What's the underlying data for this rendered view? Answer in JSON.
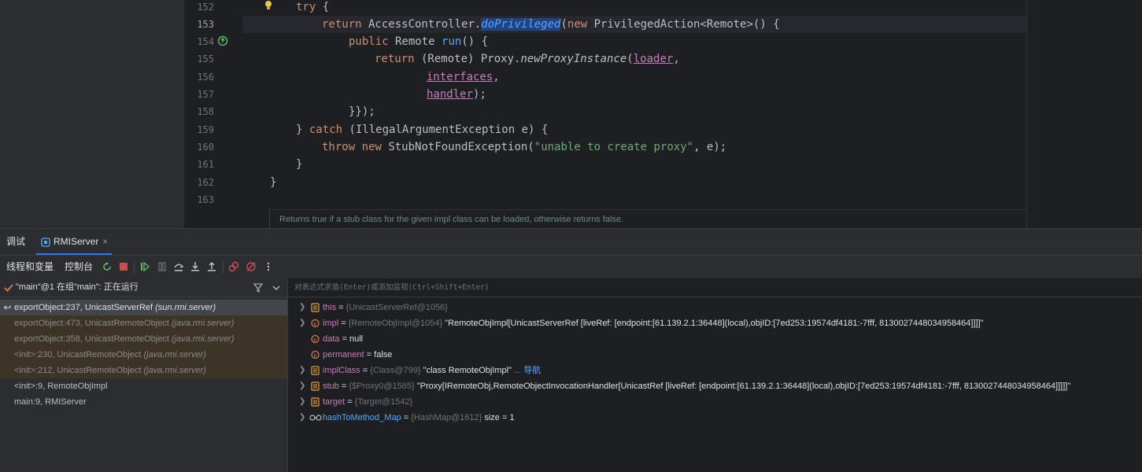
{
  "editor": {
    "line_numbers": [
      "152",
      "153",
      "154",
      "155",
      "156",
      "157",
      "158",
      "159",
      "160",
      "161",
      "162",
      "163"
    ],
    "code": {
      "l152": {
        "kw": "try",
        "rest": " {"
      },
      "l153": {
        "kw": "return",
        "a": " AccessController.",
        "fn": "doPrivileged",
        "b": "(",
        "kw2": "new",
        "c": " PrivilegedAction<Remote>() {"
      },
      "l154": {
        "kw": "public",
        "a": " Remote ",
        "fn": "run",
        "b": "() {"
      },
      "l155": {
        "kw": "return",
        "a": " (Remote) Proxy.",
        "fn": "newProxyInstance",
        "b": "(",
        "param": "loader",
        "c": ","
      },
      "l156": {
        "param": "interfaces",
        "c": ","
      },
      "l157": {
        "param": "handler",
        "c": ");"
      },
      "l158": {
        "a": "}});"
      },
      "l159": {
        "a": "} ",
        "kw": "catch",
        "b": " (IllegalArgumentException e) {"
      },
      "l160": {
        "kw": "throw",
        "a": " ",
        "kw2": "new",
        "b": " StubNotFoundException(",
        "str": "\"unable to create proxy\"",
        "c": ", e);"
      },
      "l161": {
        "a": "}"
      },
      "l162": {
        "a": "}"
      }
    },
    "doc_hint": "Returns true if a stub class for the given impl class can be loaded, otherwise returns false."
  },
  "tool_window": {
    "tab_debug": "调试",
    "tab_config": "RMIServer",
    "tab_close": "×"
  },
  "toolbar": {
    "threads_vars": "线程和变量",
    "console": "控制台"
  },
  "thread": {
    "label": "\"main\"@1 在组\"main\": 正在运行"
  },
  "frames": [
    {
      "method": "exportObject:237, UnicastServerRef ",
      "pkg": "(sun.rmi.server)"
    },
    {
      "method": "exportObject:473, UnicastRemoteObject ",
      "pkg": "(java.rmi.server)"
    },
    {
      "method": "exportObject:358, UnicastRemoteObject ",
      "pkg": "(java.rmi.server)"
    },
    {
      "method": "<init>:230, UnicastRemoteObject ",
      "pkg": "(java.rmi.server)"
    },
    {
      "method": "<init>:212, UnicastRemoteObject ",
      "pkg": "(java.rmi.server)"
    },
    {
      "method": "<init>:9, RemoteObjImpl",
      "pkg": ""
    },
    {
      "method": "main:9, RMIServer",
      "pkg": ""
    }
  ],
  "eval": {
    "placeholder": "对表达式求值(Enter)或添加监视(Ctrl+Shift+Enter)"
  },
  "variables": [
    {
      "name": "this",
      "eq": " = ",
      "type": "{UnicastServerRef@1056}",
      "value": ""
    },
    {
      "name": "impl",
      "eq": " = ",
      "type": "{RemoteObjImpl@1054}",
      "value": " \"RemoteObjImpl[UnicastServerRef [liveRef: [endpoint:[61.139.2.1:36448](local),objID:[7ed253:19574df4181:-7fff, 8130027448034958464]]]]\""
    },
    {
      "name": "data",
      "eq": " = ",
      "type": "",
      "value": "null"
    },
    {
      "name": "permanent",
      "eq": " = ",
      "type": "",
      "value": "false"
    },
    {
      "name": "implClass",
      "eq": " = ",
      "type": "{Class@799}",
      "value": " \"class RemoteObjImpl\"",
      "nav": " ... 导航"
    },
    {
      "name": "stub",
      "eq": " = ",
      "type": "{$Proxy0@1585}",
      "value": " \"Proxy[IRemoteObj,RemoteObjectInvocationHandler[UnicastRef [liveRef: [endpoint:[61.139.2.1:36448](local),objID:[7ed253:19574df4181:-7fff, 8130027448034958464]]]]]\""
    },
    {
      "name": "target",
      "eq": " = ",
      "type": "{Target@1542}",
      "value": ""
    },
    {
      "name": "hashToMethod_Map",
      "eq": " = ",
      "type": "{HashMap@1612}",
      "value": "  size = 1"
    }
  ],
  "colors": {
    "accent": "#3574f0",
    "keyword": "#cf8e6d",
    "method": "#56a8f5",
    "string": "#6aab73",
    "param": "#c77dbb",
    "stop": "#c94f4f",
    "resume": "#5fb865"
  }
}
